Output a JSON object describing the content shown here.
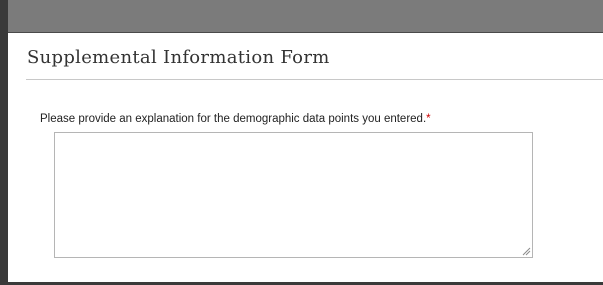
{
  "form": {
    "title": "Supplemental Information Form",
    "field_label": "Please provide an explanation for the demographic data points you entered.",
    "required_marker": "*",
    "explanation_value": ""
  },
  "icons": {
    "resize_grip": "resize-grip-icon"
  },
  "colors": {
    "header_bar": "#7b7b7b",
    "required": "#cc0000",
    "field_border": "#b5b5b5"
  }
}
